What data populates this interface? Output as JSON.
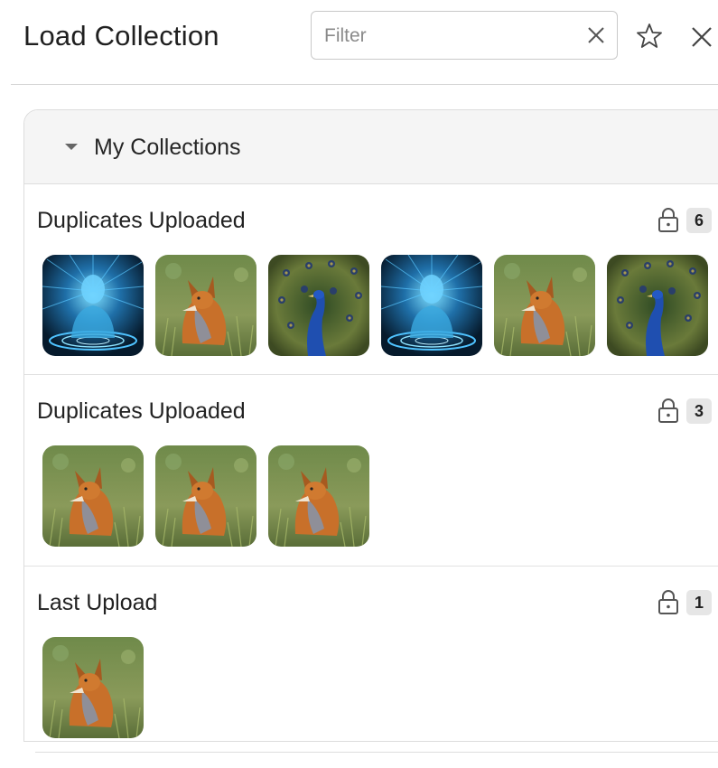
{
  "header": {
    "title": "Load Collection",
    "filter_placeholder": "Filter",
    "filter_value": ""
  },
  "icons": {
    "clear": "close-icon",
    "favorite": "star-icon",
    "close": "close-icon",
    "lock": "lock-icon",
    "caret": "caret-down-icon"
  },
  "panel": {
    "title": "My Collections",
    "expanded": true
  },
  "collections": [
    {
      "name": "Duplicates Uploaded",
      "count": "6",
      "images": [
        "cyber-figure",
        "fox",
        "peacock",
        "cyber-figure",
        "fox",
        "peacock"
      ]
    },
    {
      "name": "Duplicates Uploaded",
      "count": "3",
      "images": [
        "fox",
        "fox",
        "fox"
      ]
    },
    {
      "name": "Last Upload",
      "count": "1",
      "images": [
        "fox"
      ]
    }
  ],
  "colors": {
    "panel_header_bg": "#f5f5f5",
    "badge_bg": "#e6e6e6",
    "border": "#dcdcdc"
  }
}
